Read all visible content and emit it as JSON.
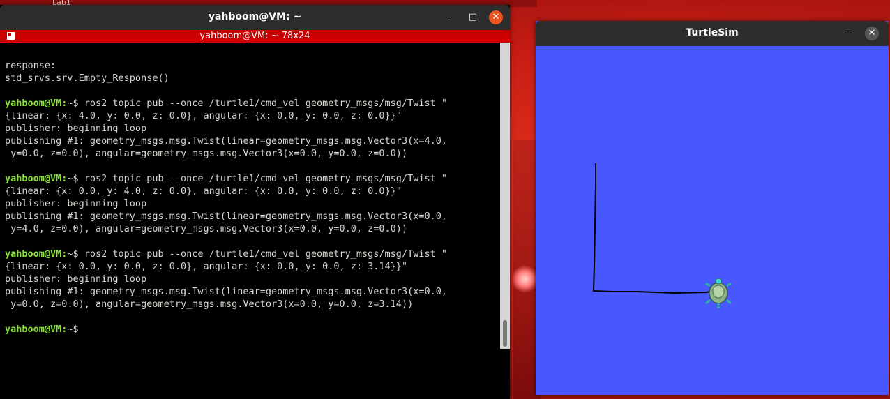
{
  "desktop": {
    "bg_label": "Lab1"
  },
  "terminal": {
    "title": "yahboom@VM: ~",
    "tab_title": "yahboom@VM: ~ 78x24",
    "controls": {
      "minimize": "–",
      "maximize": "□",
      "close": "✕"
    },
    "lines": [
      {
        "text": "response:"
      },
      {
        "text": "std_srvs.srv.Empty_Response()"
      },
      {
        "text": ""
      },
      {
        "prompt": "yahboom@VM:",
        "text": "~$ ros2 topic pub --once /turtle1/cmd_vel geometry_msgs/msg/Twist \""
      },
      {
        "text": "{linear: {x: 4.0, y: 0.0, z: 0.0}, angular: {x: 0.0, y: 0.0, z: 0.0}}\""
      },
      {
        "text": "publisher: beginning loop"
      },
      {
        "text": "publishing #1: geometry_msgs.msg.Twist(linear=geometry_msgs.msg.Vector3(x=4.0,"
      },
      {
        "text": " y=0.0, z=0.0), angular=geometry_msgs.msg.Vector3(x=0.0, y=0.0, z=0.0))"
      },
      {
        "text": ""
      },
      {
        "prompt": "yahboom@VM:",
        "text": "~$ ros2 topic pub --once /turtle1/cmd_vel geometry_msgs/msg/Twist \""
      },
      {
        "text": "{linear: {x: 0.0, y: 4.0, z: 0.0}, angular: {x: 0.0, y: 0.0, z: 0.0}}\""
      },
      {
        "text": "publisher: beginning loop"
      },
      {
        "text": "publishing #1: geometry_msgs.msg.Twist(linear=geometry_msgs.msg.Vector3(x=0.0,"
      },
      {
        "text": " y=4.0, z=0.0), angular=geometry_msgs.msg.Vector3(x=0.0, y=0.0, z=0.0))"
      },
      {
        "text": ""
      },
      {
        "prompt": "yahboom@VM:",
        "text": "~$ ros2 topic pub --once /turtle1/cmd_vel geometry_msgs/msg/Twist \""
      },
      {
        "text": "{linear: {x: 0.0, y: 0.0, z: 0.0}, angular: {x: 0.0, y: 0.0, z: 3.14}}\""
      },
      {
        "text": "publisher: beginning loop"
      },
      {
        "text": "publishing #1: geometry_msgs.msg.Twist(linear=geometry_msgs.msg.Vector3(x=0.0,"
      },
      {
        "text": " y=0.0, z=0.0), angular=geometry_msgs.msg.Vector3(x=0.0, y=0.0, z=3.14))"
      },
      {
        "text": ""
      },
      {
        "prompt": "yahboom@VM:",
        "text": "~$"
      }
    ]
  },
  "turtlesim": {
    "title": "TurtleSim",
    "controls": {
      "minimize": "–",
      "close": "✕"
    },
    "colors": {
      "background": "#4857fe",
      "pen": "#000000",
      "turtle": "#8fb28c"
    }
  }
}
